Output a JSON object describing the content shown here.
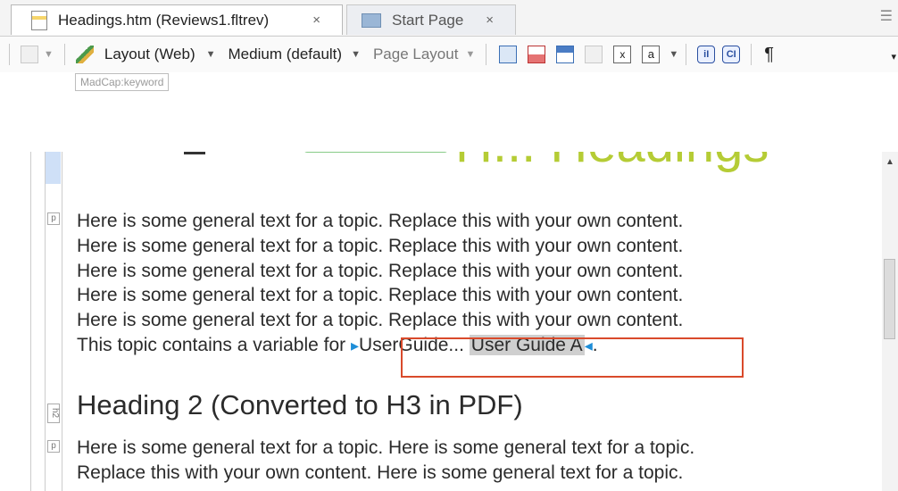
{
  "tabs": [
    {
      "label": "Headings.htm (Reviews1.fltrev)",
      "close": "×",
      "active": true
    },
    {
      "label": "Start Page",
      "close": "×",
      "active": false
    }
  ],
  "toolbar": {
    "layout_label": "Layout (Web)",
    "medium_label": "Medium (default)",
    "page_layout_label": "Page Layout",
    "pilcrow": "¶",
    "x_glyph": "x",
    "a_glyph": "a",
    "v1_glyph": "iI",
    "v2_glyph": "CI"
  },
  "keyword_tag": "MadCap:keyword",
  "editor": {
    "heading1": "H... Headings",
    "tag_p": "p",
    "tag_h2": "h2",
    "para1": [
      "Here is some general text for a topic. Replace this with your own content.",
      "Here is some general text for a topic. Replace this with your own content.",
      "Here is some general text for a topic. Replace this with your own content.",
      "Here is some general text for a topic. Replace this with your own content.",
      "Here is some general text for a topic. Replace this with your own content."
    ],
    "var_line_prefix": "This topic contains a variable for",
    "var_name": "UserGuide...",
    "var_value": "User Guide A",
    "var_suffix": ".",
    "heading2": "Heading 2 (Converted to H3 in PDF)",
    "para2": [
      "Here is some general text for a topic. Here is some general text for a topic.",
      "Replace this with your own content. Here is some general text for a topic."
    ]
  }
}
